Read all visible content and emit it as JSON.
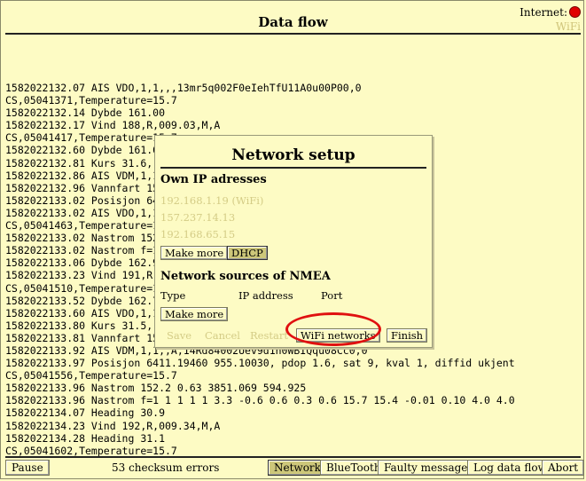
{
  "header": {
    "title": "Data flow",
    "internet_label": "Internet:",
    "wifi_label": "WiFi",
    "status_color": "#e00000"
  },
  "log_lines": [
    "1582022132.07 AIS VDO,1,1,,,13mr5q002F0eIehTfU11A0u00P00,0",
    "CS,05041371,Temperature=15.7",
    "1582022132.14 Dybde 161.00",
    "1582022132.17 Vind 188,R,009.03,M,A",
    "CS,05041417,Temperature=15.7",
    "1582022132.60 Dybde 161.00",
    "1582022132.81 Kurs 31.6, knop 14",
    "1582022132.86 AIS VDM,1,1,,B,4",
    "1582022132.96 Vannfart 15.60",
    "1582022133.02 Posisjon 6411.191",
    "1582022133.02 AIS VDO,1,1,,,13",
    "CS,05041463,Temperature=15.7",
    "1582022133.02 Nastrom 152.2 0.6",
    "1582022133.02 Nastrom f=1 1 1 1",
    "1582022133.06 Dybde 162.97",
    "1582022133.23 Vind 191,R,009.09",
    "CS,05041510,Temperature=15.7",
    "1582022133.52 Dybde 162.79",
    "1582022133.60 AIS VDO,1,1,,A,1",
    "1582022133.80 Kurs 31.5, knop 15",
    "1582022133.81 Vannfart 15.70",
    "1582022133.92 AIS VDM,1,1,,A,14Rd84002Uev9d1n0WBIQqu08Cc0,0",
    "1582022133.97 Posisjon 6411.19460 955.10030, pdop 1.6, sat 9, kval 1, diffid ukjent",
    "CS,05041556,Temperature=15.7",
    "1582022133.96 Nastrom 152.2 0.63 3851.069 594.925",
    "1582022133.96 Nastrom f=1 1 1 1 1 3.3 -0.6 0.6 0.3 0.6 15.7 15.4 -0.01 0.10 4.0 4.0",
    "1582022134.07 Heading 30.9",
    "1582022134.23 Vind 192,R,009.34,M,A",
    "1582022134.28 Heading 31.1",
    "CS,05041602,Temperature=15.7"
  ],
  "statusbar": {
    "pause_label": "Pause",
    "checksum_text": "53 checksum errors",
    "network_label": "Network",
    "bluetooth_label": "BlueTooth",
    "faulty_label": "Faulty messages",
    "logflow_label": "Log data flow",
    "abort_label": "Abort"
  },
  "dialog": {
    "title": "Network setup",
    "own_ip_heading": "Own IP adresses",
    "ip_addresses": [
      "192.168.1.19 (WiFi)",
      "157.237.14.13",
      "192.168.65.15"
    ],
    "make_more_label": "Make more",
    "dhcp_label": "DHCP",
    "nmea_heading": "Network sources of NMEA",
    "col_type": "Type",
    "col_ip": "IP address",
    "col_port": "Port",
    "make_more2_label": "Make more",
    "save_label": "Save",
    "cancel_label": "Cancel",
    "restart_label": "Restart",
    "wifi_networks_label": "WiFi networks",
    "finish_label": "Finish"
  }
}
